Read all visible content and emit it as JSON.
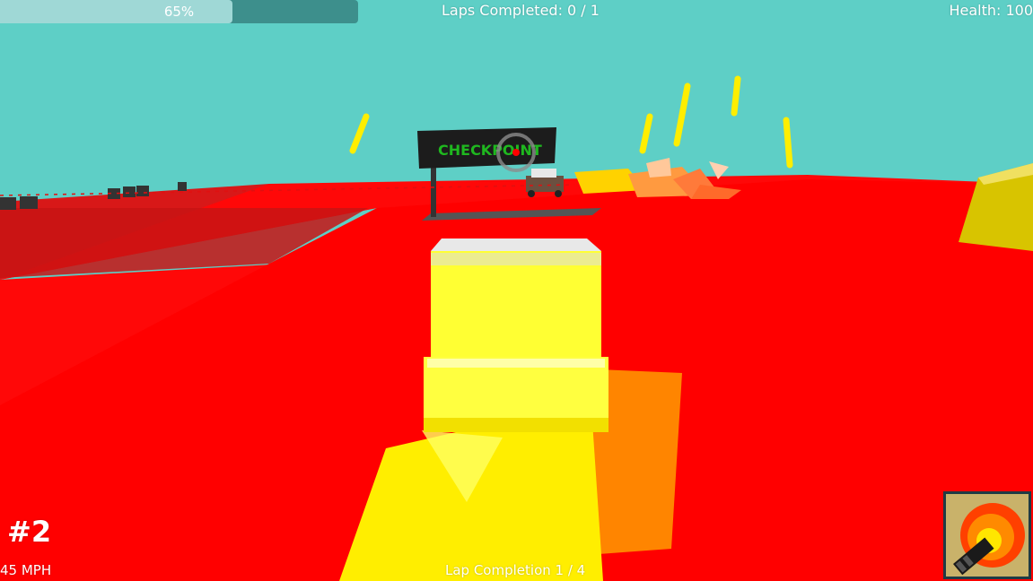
{
  "hud": {
    "progress": {
      "value": 0.65,
      "label": "65%"
    },
    "laps_completed": "Laps Completed: 0 / 1",
    "health": "Health: 100",
    "position": "#2",
    "speed": "45 MPH",
    "lap_completion": "Lap Completion 1 / 4",
    "weapon_icon": "minigun-explosion-icon"
  },
  "scene": {
    "checkpoint_sign": "CHECKPOINT"
  },
  "colors": {
    "sky": "#5ecfc6",
    "track": "#ff0000",
    "player_car": "#ffff33",
    "progress_track": "#3d8f8c",
    "progress_fill": "#9fd8d6"
  }
}
